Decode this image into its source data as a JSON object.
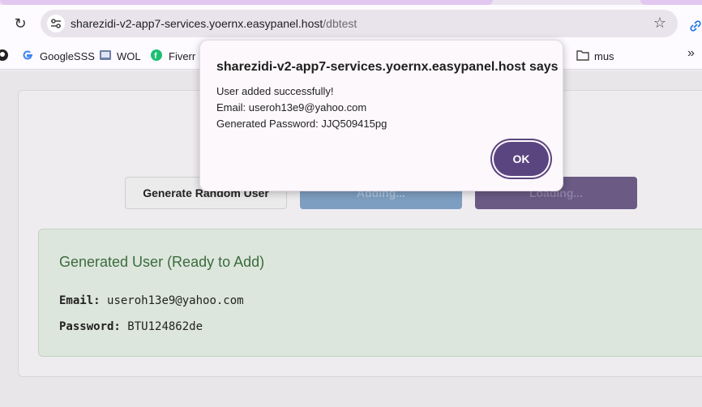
{
  "browser": {
    "url_host": "sharezidi-v2-app7-services.yoernx.easypanel.host",
    "url_path": "/dbtest",
    "bookmarks": [
      {
        "label": "",
        "icon": "github-icon"
      },
      {
        "label": "GoogleSSS",
        "icon": "google-icon"
      },
      {
        "label": "WOL",
        "icon": "wol-icon"
      },
      {
        "label": "Fiverr",
        "icon": "fiverr-icon"
      },
      {
        "label": "mus",
        "icon": "folder-icon"
      }
    ]
  },
  "page": {
    "buttons": {
      "generate": "Generate Random User",
      "adding": "Adding...",
      "loading": "Loading..."
    },
    "generated": {
      "title": "Generated User (Ready to Add)",
      "email_label": "Email:",
      "email_value": "useroh13e9@yahoo.com",
      "password_label": "Password:",
      "password_value": "BTU124862de"
    }
  },
  "dialog": {
    "title": "sharezidi-v2-app7-services.yoernx.easypanel.host says",
    "line1": "User added successfully!",
    "line2": "Email: useroh13e9@yahoo.com",
    "line3": "Generated Password: JJQ509415pg",
    "ok_label": "OK"
  },
  "colors": {
    "accent": "#5b4580",
    "add_button": "#7e9ec1",
    "success_title": "#3b6b3e"
  }
}
